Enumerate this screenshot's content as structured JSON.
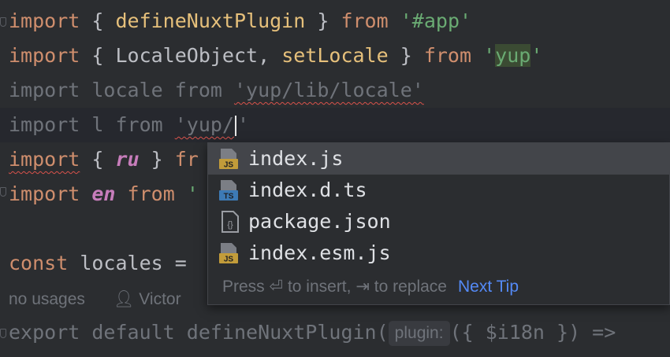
{
  "editor": {
    "lines": [
      {
        "t1": "import",
        "t2": " { ",
        "t3": "defineNuxtPlugin",
        "t4": " } ",
        "t5": "from",
        "t6": " ",
        "t7": "'#app'"
      },
      {
        "t1": "import",
        "t2": " { LocaleObject, ",
        "t3": "setLocale",
        "t4": " } ",
        "t5": "from",
        "t6": " ",
        "t7a": "'",
        "t7b": "yup",
        "t7c": "'"
      },
      {
        "text_a": "import locale from ",
        "text_b": "'yup/lib/locale'"
      },
      {
        "text_a": "import l from ",
        "text_b": "'yup/",
        "text_c": "'"
      },
      {
        "t1": "import",
        "t2": " { ",
        "t3": "ru",
        "t4": " } ",
        "t5": "fr"
      },
      {
        "t1": "import",
        "t2": " ",
        "t3": "en",
        "t4": " ",
        "t5": "from",
        "t6": " '"
      },
      {
        "t1": "const",
        "t2": " locales = "
      },
      {
        "t1": "export default ",
        "t2": "defineNuxtPlugin",
        "t3": "(",
        "t4": "({ $i18n }) =>"
      }
    ],
    "usage_hint": "no usages",
    "author_hint": "Victor",
    "inlay_param": "plugin:"
  },
  "completion": {
    "items": [
      {
        "label": "index.js",
        "icon": "js-file-icon",
        "badge": "JS",
        "badge_color": "#b38b2d"
      },
      {
        "label": "index.d.ts",
        "icon": "ts-file-icon",
        "badge": "TS",
        "badge_color": "#3d7ab5"
      },
      {
        "label": "package.json",
        "icon": "json-file-icon",
        "badge": "{}",
        "badge_color": "#6f737a"
      },
      {
        "label": "index.esm.js",
        "icon": "js-file-icon",
        "badge": "JS",
        "badge_color": "#b38b2d"
      }
    ],
    "selected_index": 0,
    "footer_text": "Press ⏎ to insert, ⇥ to replace",
    "tip_link": "Next Tip"
  },
  "colors": {
    "background": "#2b2d30",
    "keyword": "#cf8e6d",
    "function": "#e6c07b",
    "string": "#6aab73",
    "link": "#548af7"
  }
}
